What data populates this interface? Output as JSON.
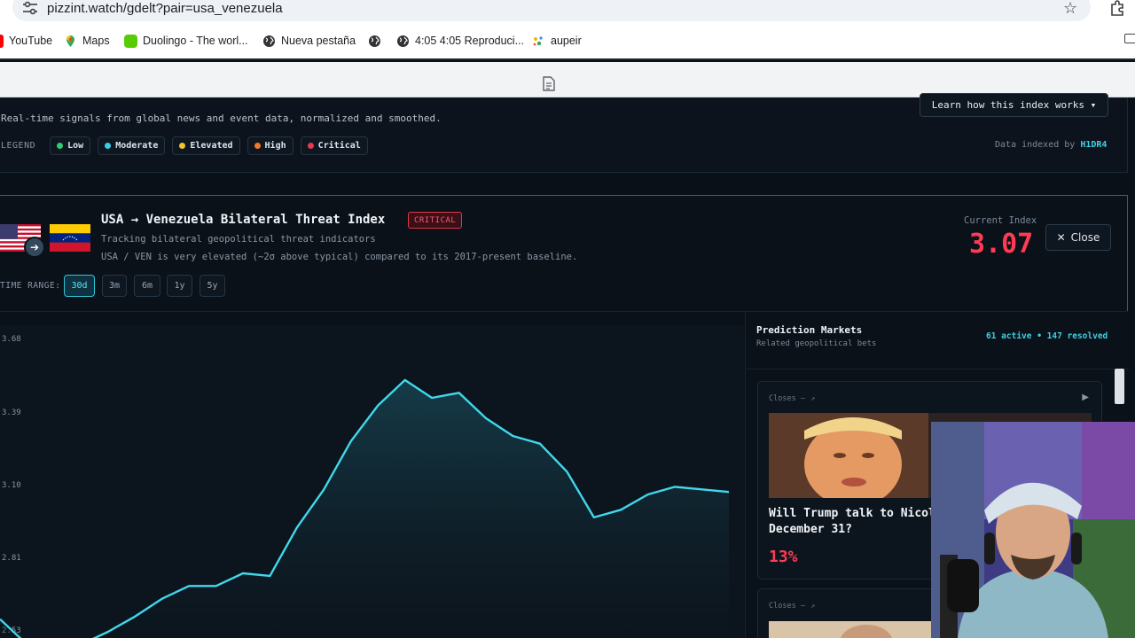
{
  "browser": {
    "url": "pizzint.watch/gdelt?pair=usa_venezuela",
    "bookmarks": [
      {
        "label": "YouTube",
        "icon": "youtube-icon"
      },
      {
        "label": "Maps",
        "icon": "maps-pin-icon"
      },
      {
        "label": "Duolingo - The worl...",
        "icon": "duolingo-icon"
      },
      {
        "label": "Nueva pestaña",
        "icon": "globe-icon"
      },
      {
        "label": "",
        "icon": "globe-icon"
      },
      {
        "label": "4:05 4:05 Reproduci...",
        "icon": "globe-icon"
      },
      {
        "label": "aupeir",
        "icon": "sparkle-icon"
      }
    ]
  },
  "header": {
    "subtitle": "Real-time signals from global news and event data, normalized and smoothed.",
    "legend_label": "LEGEND",
    "legend": [
      {
        "label": "Low",
        "color": "#2ecc71"
      },
      {
        "label": "Moderate",
        "color": "#35d0e8"
      },
      {
        "label": "Elevated",
        "color": "#f1c232"
      },
      {
        "label": "High",
        "color": "#f07a2a"
      },
      {
        "label": "Critical",
        "color": "#e8384f"
      }
    ],
    "learn_button": "Learn how this index works ▾",
    "indexed_prefix": "Data indexed by",
    "indexed_brand": "H1DR4"
  },
  "index": {
    "title": "USA → Venezuela Bilateral Threat Index",
    "badge": "CRITICAL",
    "tracking": "Tracking bilateral geopolitical threat indicators",
    "description": "USA / VEN is very elevated (~2σ above typical) compared to its 2017-present baseline.",
    "current_label": "Current Index",
    "current_value": "3.07",
    "close_label": "Close",
    "time_range_label": "TIME RANGE:",
    "time_ranges": [
      "30d",
      "3m",
      "6m",
      "1y",
      "5y"
    ],
    "active_range": "30d"
  },
  "chart_data": {
    "type": "area",
    "y_ticks": [
      "3.68",
      "3.39",
      "3.10",
      "2.81",
      "2.53"
    ],
    "ylim": [
      2.53,
      3.68
    ],
    "grid": false,
    "color": "#40d8ea",
    "values": [
      2.58,
      2.48,
      2.45,
      2.48,
      2.53,
      2.59,
      2.66,
      2.71,
      2.71,
      2.76,
      2.75,
      2.94,
      3.09,
      3.28,
      3.42,
      3.52,
      3.45,
      3.47,
      3.37,
      3.3,
      3.27,
      3.16,
      2.98,
      3.01,
      3.07,
      3.1,
      3.09,
      3.08
    ]
  },
  "markets": {
    "title": "Prediction Markets",
    "subtitle": "Related geopolitical bets",
    "counts": "61 active • 147 resolved",
    "cards": [
      {
        "closes": "Closes –",
        "question": "Will Trump talk to Nicol December 31?",
        "probability": "13%"
      },
      {
        "closes": "Closes –",
        "question": "",
        "probability": ""
      }
    ]
  }
}
